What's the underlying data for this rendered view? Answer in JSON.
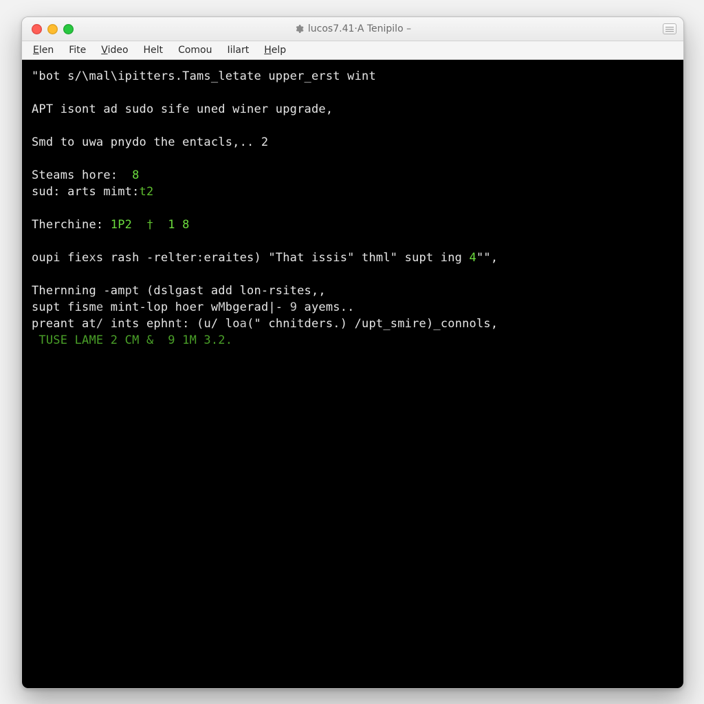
{
  "window": {
    "title": "lucos7.41·A Tenipilo –"
  },
  "menubar": {
    "items": [
      {
        "label": "Elen",
        "mnemonic_index": 0
      },
      {
        "label": "Fite",
        "mnemonic_index": -1
      },
      {
        "label": "Video",
        "mnemonic_index": 0
      },
      {
        "label": "Helt",
        "mnemonic_index": -1
      },
      {
        "label": "Comou",
        "mnemonic_index": -1
      },
      {
        "label": "Iilart",
        "mnemonic_index": -1
      },
      {
        "label": "Help",
        "mnemonic_index": 0
      }
    ]
  },
  "terminal": {
    "lines": [
      {
        "segments": [
          {
            "t": "\"bot s/\\mal\\ipitters.Tams_letate upper_erst wint"
          }
        ]
      },
      {
        "segments": [
          {
            "t": ""
          }
        ]
      },
      {
        "segments": [
          {
            "t": "APT isont ad sudo sife uned winer upgrade,"
          }
        ]
      },
      {
        "segments": [
          {
            "t": ""
          }
        ]
      },
      {
        "segments": [
          {
            "t": "Smd to uwa pnydo the entacls,.. 2"
          }
        ]
      },
      {
        "segments": [
          {
            "t": ""
          }
        ]
      },
      {
        "segments": [
          {
            "t": "Steams hore:  "
          },
          {
            "t": "8",
            "cls": "g"
          }
        ]
      },
      {
        "segments": [
          {
            "t": "sud: arts mimt:"
          },
          {
            "t": "t2",
            "cls": "g2"
          }
        ]
      },
      {
        "segments": [
          {
            "t": ""
          }
        ]
      },
      {
        "segments": [
          {
            "t": "Therchine: "
          },
          {
            "t": "1P2  ",
            "cls": "g"
          },
          {
            "t": "†",
            "cls": "g2"
          },
          {
            "t": "  1 8",
            "cls": "g"
          }
        ]
      },
      {
        "segments": [
          {
            "t": ""
          }
        ]
      },
      {
        "segments": [
          {
            "t": "oupi fie"
          },
          {
            "t": "x",
            "cls": "wd"
          },
          {
            "t": "s rash -relter"
          },
          {
            "t": ":",
            "cls": "wd"
          },
          {
            "t": "eraites) \"That issis\" thml\" supt ing "
          },
          {
            "t": "4",
            "cls": "g"
          },
          {
            "t": "\"\","
          }
        ]
      },
      {
        "segments": [
          {
            "t": ""
          }
        ]
      },
      {
        "segments": [
          {
            "t": "Thernning -am"
          },
          {
            "t": "p",
            "cls": "wd"
          },
          {
            "t": "t (dslgast add lon-rsites,,"
          }
        ]
      },
      {
        "segments": [
          {
            "t": "supt fism"
          },
          {
            "t": "e",
            "cls": "wd"
          },
          {
            "t": " mint-lop hoer w"
          },
          {
            "t": "M",
            "cls": "wd"
          },
          {
            "t": "bgerad|- "
          },
          {
            "t": "9",
            "cls": "wd"
          },
          {
            "t": " ayems.."
          }
        ]
      },
      {
        "segments": [
          {
            "t": "preant at"
          },
          {
            "t": "/",
            "cls": "wd"
          },
          {
            "t": " ints ephn"
          },
          {
            "t": "t",
            "cls": "wd"
          },
          {
            "t": ": (u/ lo"
          },
          {
            "t": "a",
            "cls": "wd"
          },
          {
            "t": "(\" chnitders.) /upt_smire)_connols,"
          }
        ]
      },
      {
        "segments": [
          {
            "t": " TUSE LAME 2 CM &  9 1M 3.2.",
            "cls": "gd"
          }
        ]
      }
    ]
  },
  "colors": {
    "terminal_bg": "#000000",
    "terminal_fg": "#e6e6e6",
    "bright_green": "#6cdc3e",
    "dim_green": "#4aa028",
    "window_chrome": "#e9e9e9"
  }
}
